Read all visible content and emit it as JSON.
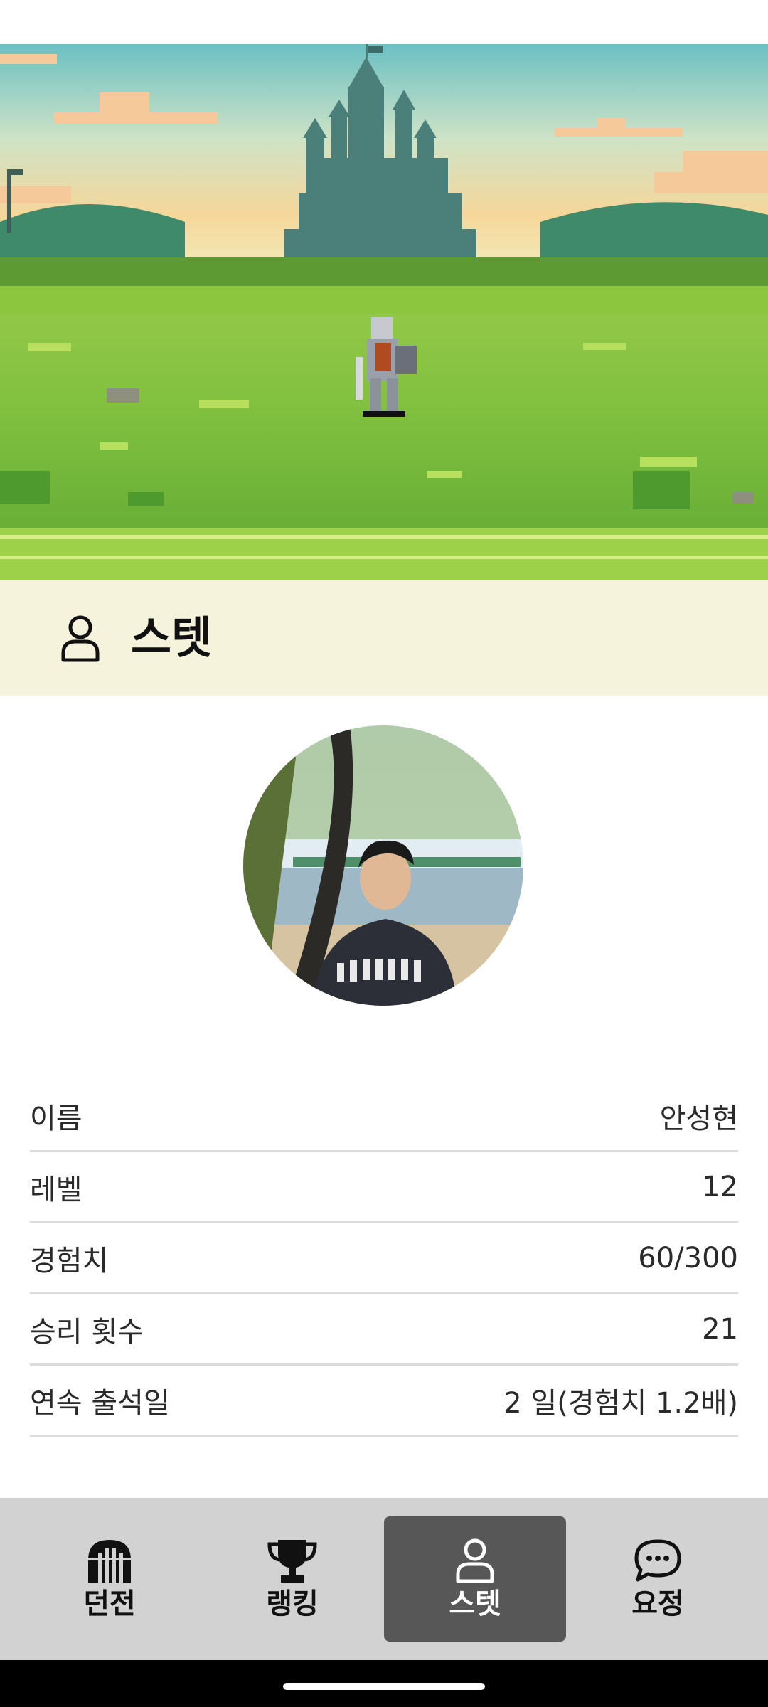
{
  "header": {
    "title": "스텟",
    "icon": "person-icon"
  },
  "profile": {
    "avatar": "profile-photo"
  },
  "stats": [
    {
      "label": "이름",
      "value": "안성현"
    },
    {
      "label": "레벨",
      "value": "12"
    },
    {
      "label": "경험치",
      "value": "60/300"
    },
    {
      "label": "승리 횟수",
      "value": "21"
    },
    {
      "label": "연속 출석일",
      "value": "2 일(경험치 1.2배)"
    }
  ],
  "nav": {
    "active": "스텟",
    "items": [
      {
        "label": "던전",
        "icon": "dungeon-gate-icon"
      },
      {
        "label": "랭킹",
        "icon": "trophy-icon"
      },
      {
        "label": "스텟",
        "icon": "person-icon"
      },
      {
        "label": "요정",
        "icon": "chat-bubble-icon"
      }
    ]
  },
  "colors": {
    "header_bg": "#f5f3dc",
    "nav_bg": "#d2d2d2",
    "nav_active_bg": "#575757"
  }
}
